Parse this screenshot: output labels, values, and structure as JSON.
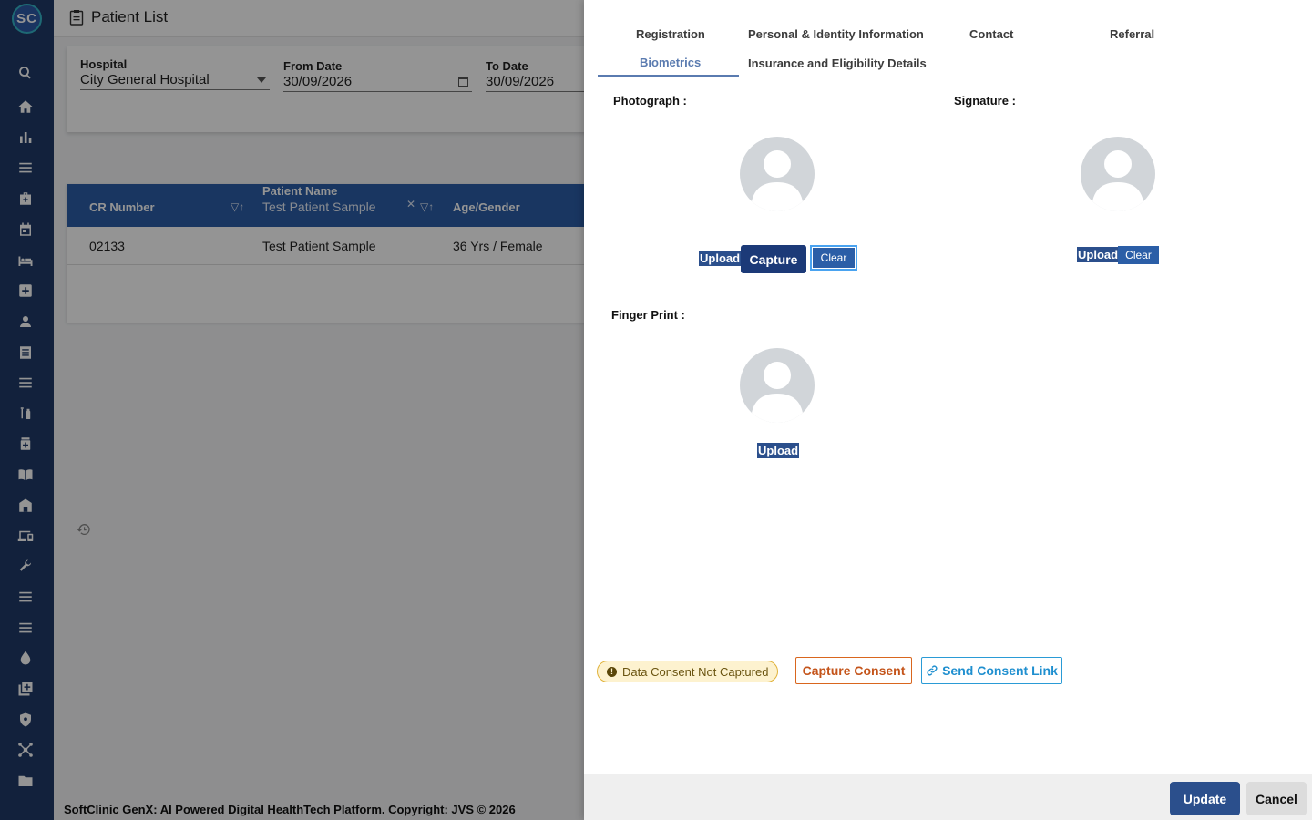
{
  "app": {
    "logo_text": "SC",
    "page_title": "Patient List"
  },
  "sidebar": {
    "icons": [
      "search-icon",
      "home-icon",
      "bar-chart-icon",
      "menu-icon",
      "medical-bag-icon",
      "calendar-icon",
      "bed-icon",
      "add-box-icon",
      "person-icon",
      "document-icon",
      "menu-icon",
      "syringe-icon",
      "medicine-icon",
      "book-icon",
      "building-icon",
      "devices-icon",
      "wrench-icon",
      "menu-icon",
      "menu-icon",
      "drop-icon",
      "add-library-icon",
      "shield-icon",
      "molecule-icon",
      "folder-icon"
    ]
  },
  "filters": {
    "hospital": {
      "label": "Hospital",
      "value": "City General Hospital"
    },
    "from_date": {
      "label": "From Date",
      "value": "30/09/2026"
    },
    "to_date": {
      "label": "To Date",
      "value": "30/09/2026"
    }
  },
  "table": {
    "columns": {
      "cr_number": "CR Number",
      "patient_name": "Patient Name",
      "patient_name_filter": "Test Patient Sample",
      "age_gender": "Age/Gender"
    },
    "rows": [
      {
        "cr_number": "02133",
        "patient_name": "Test Patient Sample",
        "age_gender": "36 Yrs / Female"
      }
    ]
  },
  "footer": {
    "copyright": "SoftClinic GenX: AI Powered Digital HealthTech Platform. Copyright: JVS © 2026"
  },
  "drawer": {
    "tabs": {
      "registration": "Registration",
      "personal": "Personal & Identity Information",
      "contact": "Contact",
      "referral": "Referral",
      "biometrics": "Biometrics",
      "insurance": "Insurance and Eligibility Details"
    },
    "active_tab": "Biometrics",
    "photograph": {
      "label": "Photograph :",
      "upload": "Upload",
      "capture": "Capture",
      "clear": "Clear"
    },
    "signature": {
      "label": "Signature :",
      "upload": "Upload",
      "clear": "Clear"
    },
    "fingerprint": {
      "label": "Finger Print :",
      "upload": "Upload"
    },
    "consent": {
      "status": "Data Consent Not Captured",
      "capture_button": "Capture Consent",
      "send_link_button": "Send Consent Link"
    },
    "footer": {
      "update": "Update",
      "cancel": "Cancel"
    }
  },
  "colors": {
    "rail": "#1f3a68",
    "primary": "#2b4f8c",
    "table_header": "#2b5ea7",
    "active_tab": "#5a7bb0",
    "consent_badge": "#fdf2cf",
    "capture_consent": "#d9661e",
    "send_link": "#2a9bd6"
  }
}
